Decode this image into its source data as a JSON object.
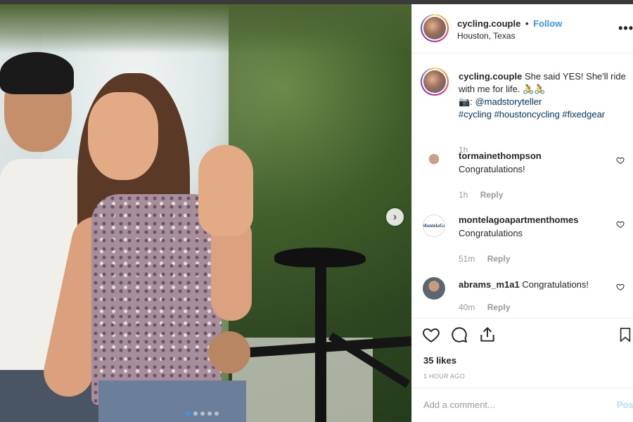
{
  "post": {
    "username": "cycling.couple",
    "separator": "•",
    "follow_label": "Follow",
    "location": "Houston, Texas",
    "more_icon": "more-options-icon"
  },
  "caption": {
    "username": "cycling.couple",
    "text": "She said YES! She'll ride with me for life. 🚴🚴",
    "camera_glyph": "📷:",
    "credit": "@madstoryteller",
    "hashtags": "#cycling #houstoncycling #fixedgear",
    "time": "1h"
  },
  "comments": [
    {
      "username": "tormainethompson",
      "text": "Congratulations!",
      "time": "1h",
      "reply": "Reply"
    },
    {
      "username": "montelagoapartmenthomes",
      "text": "Congratulations",
      "time": "51m",
      "reply": "Reply",
      "avatar_text": "MontelaGo"
    },
    {
      "username": "abrams_m1a1",
      "text": "Congratulations!",
      "time": "40m",
      "reply": "Reply"
    }
  ],
  "actions": {
    "likes": "35 likes",
    "posted_ago": "1 HOUR AGO"
  },
  "add_comment": {
    "placeholder": "Add a comment...",
    "post_label": "Post"
  },
  "carousel": {
    "next_glyph": "›",
    "slide_count": 5,
    "active_slide": 1
  },
  "colors": {
    "link": "#3897f0",
    "text": "#262626",
    "muted": "#999999"
  }
}
